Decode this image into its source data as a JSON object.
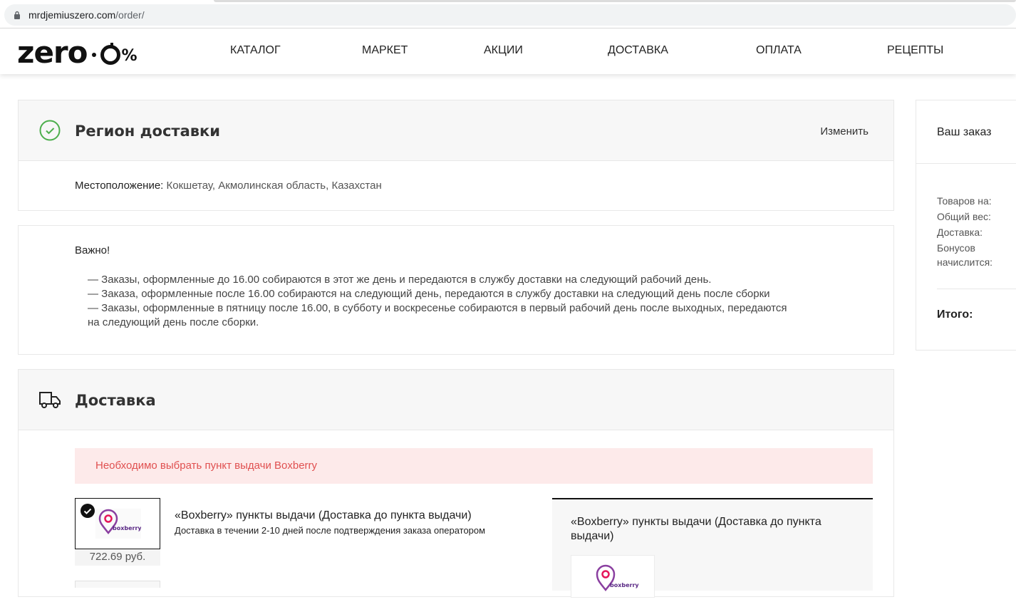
{
  "browser": {
    "url_host": "mrdjemiuszero.com",
    "url_path": "/order/"
  },
  "header": {
    "logo_word": "zero",
    "logo_pct": "%",
    "nav": [
      "КАТАЛОГ",
      "МАРКЕТ",
      "АКЦИИ",
      "ДОСТАВКА",
      "ОПЛАТА",
      "РЕЦЕПТЫ"
    ]
  },
  "region": {
    "title": "Регион доставки",
    "change_label": "Изменить",
    "location_label": "Местоположение:",
    "location_value": "Кокшетау, Акмолинская область, Казахстан"
  },
  "notice": {
    "title": "Важно!",
    "rules": [
      "— Заказы, оформленные до 16.00 собираются в этот же день и передаются в службу доставки на следующий рабочий день.",
      "— Заказа, оформленные после 16.00 собираются на следующий день, передаются в службу доставки на следующий день после сборки",
      "— Заказы, оформленные в пятницу после 16.00, в субботу и воскресенье собираются в первый рабочий день после выходных, передаются",
      "на следующий день после сборки."
    ]
  },
  "delivery": {
    "title": "Доставка",
    "alert": "Необходимо выбрать пункт выдачи Boxberry",
    "service_name": "«Boxberry» пункты выдачи (Доставка до пункта выдачи)",
    "service_desc": "Доставка в течении 2-10 дней после подтверждения заказа оператором",
    "service_price": "722.69 руб.",
    "service_logo_text": "boxberry",
    "detail_title": "«Boxberry» пункты выдачи (Доставка до пункта выдачи)"
  },
  "order": {
    "title": "Ваш заказ",
    "labels": [
      "Товаров на:",
      "Общий вес:",
      "Доставка:",
      "Бонусов",
      "начислится:"
    ],
    "total_label": "Итого:"
  },
  "colors": {
    "accent_green": "#4cae4c",
    "alert_bg": "#fdeaea",
    "alert_text": "#e05050",
    "boxberry_pink": "#e5175b",
    "boxberry_purple": "#5b2a86"
  }
}
